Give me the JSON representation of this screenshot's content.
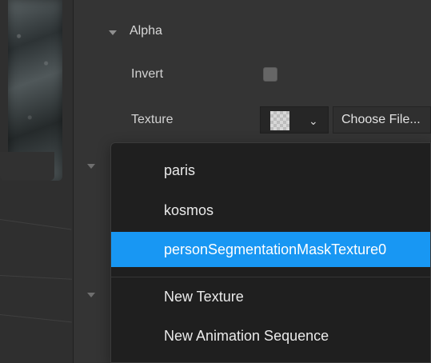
{
  "inspector": {
    "section_title": "Alpha",
    "invert_label": "Invert",
    "texture_label": "Texture",
    "choose_file_label": "Choose File..."
  },
  "menu": {
    "items": [
      {
        "label": "paris"
      },
      {
        "label": "kosmos"
      },
      {
        "label": "personSegmentationMaskTexture0"
      }
    ],
    "actions": [
      {
        "label": "New Texture"
      },
      {
        "label": "New Animation Sequence"
      }
    ]
  },
  "icons": {
    "section_collapse": "chevron-down-icon",
    "dropdown": "chevron-down-icon",
    "texture_preview": "checkerboard-icon",
    "invert_toggle": "checkbox"
  },
  "colors": {
    "background": "#343434",
    "menu_background": "#1f1f1f",
    "selection": "#1897f3"
  }
}
